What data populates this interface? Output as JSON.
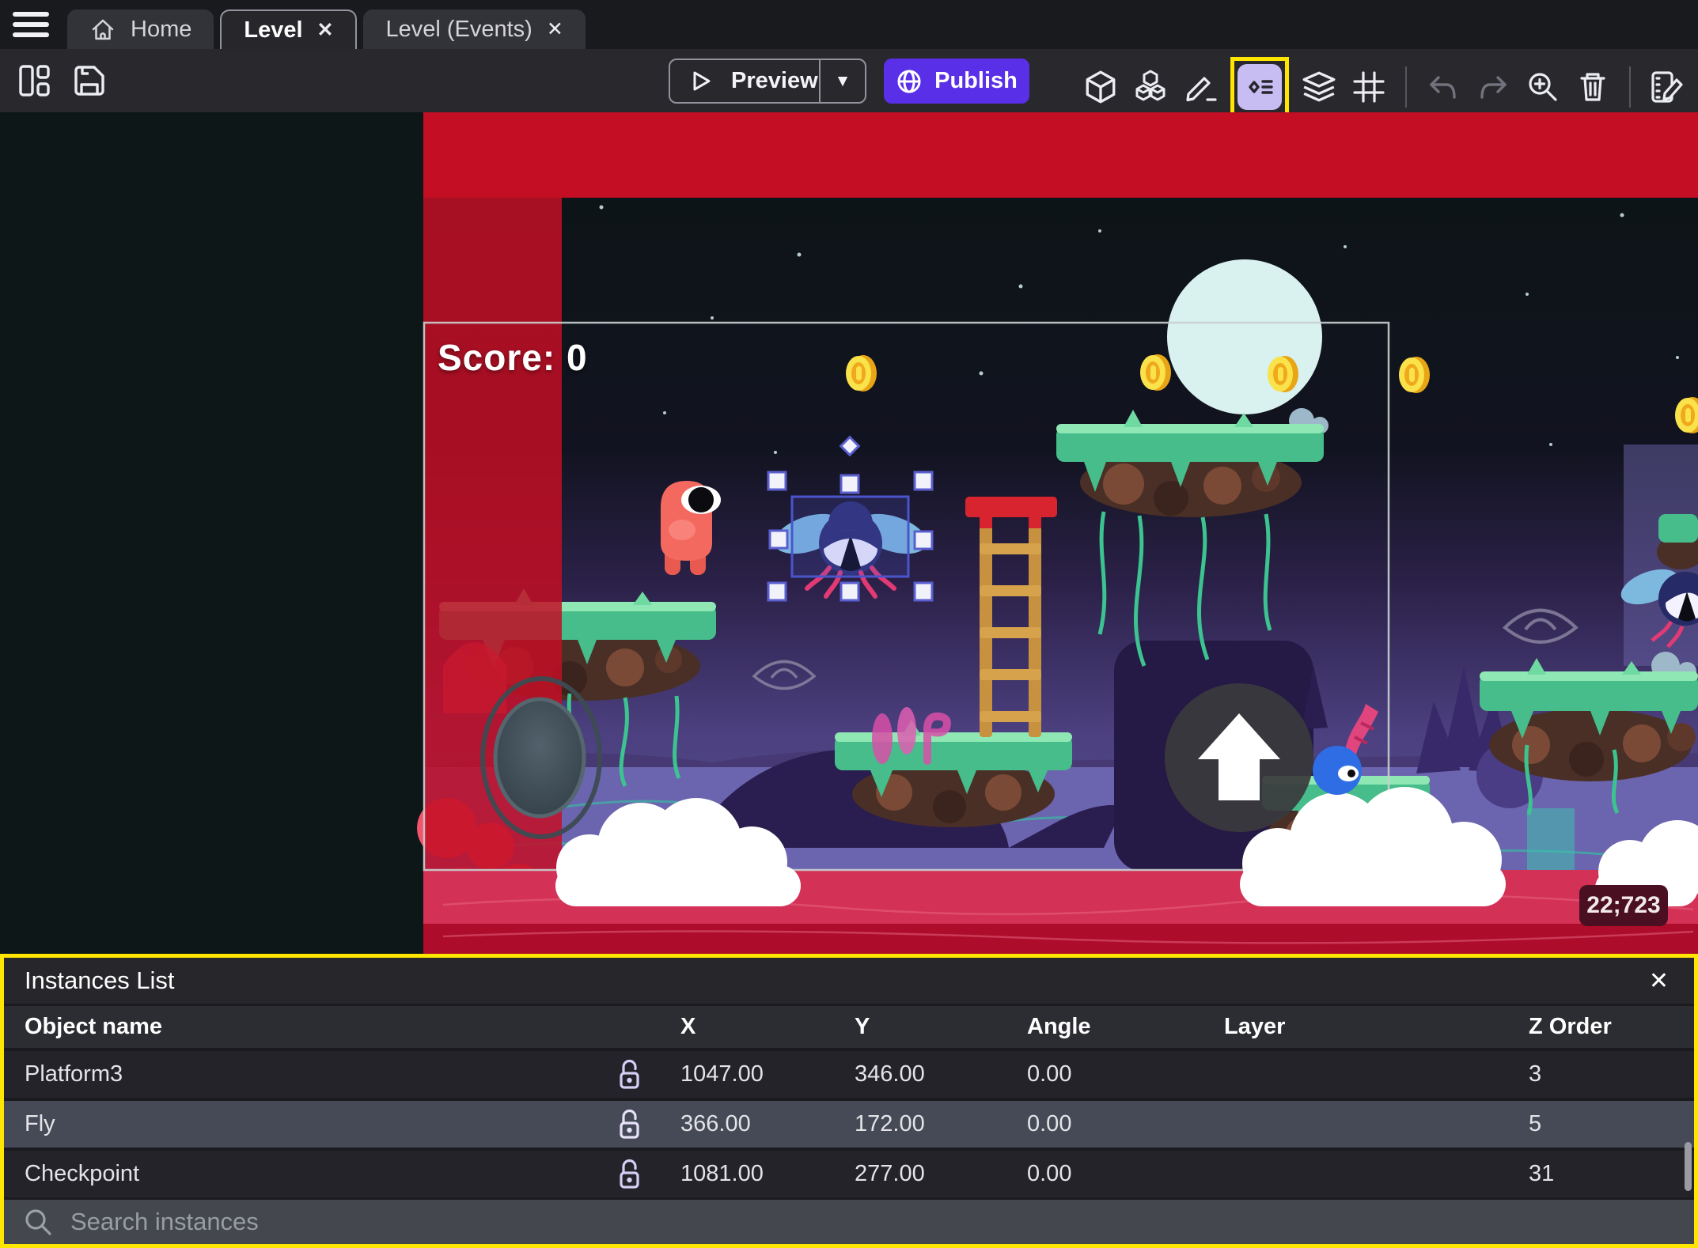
{
  "tabs": {
    "home": "Home",
    "level": "Level",
    "events": "Level (Events)"
  },
  "icons": {
    "close": "✕",
    "caret": "▼"
  },
  "toolbar": {
    "preview": "Preview",
    "publish": "Publish"
  },
  "canvas": {
    "score": "Score: 0",
    "coords": "22;723"
  },
  "panel": {
    "title": "Instances List",
    "columns": {
      "name": "Object name",
      "x": "X",
      "y": "Y",
      "angle": "Angle",
      "layer": "Layer",
      "z": "Z Order"
    },
    "rows": [
      {
        "name": "Platform3",
        "x": "1047.00",
        "y": "346.00",
        "angle": "0.00",
        "layer": "",
        "z": "3"
      },
      {
        "name": "Fly",
        "x": "366.00",
        "y": "172.00",
        "angle": "0.00",
        "layer": "",
        "z": "5"
      },
      {
        "name": "Checkpoint",
        "x": "1081.00",
        "y": "277.00",
        "angle": "0.00",
        "layer": "",
        "z": "31"
      }
    ],
    "search_placeholder": "Search instances"
  },
  "colors": {
    "highlight": "#FFE600",
    "publish": "#5A2FE8",
    "instances_chip": "#C8BDF2",
    "out_of_bounds_red": "#C30E24",
    "selection_blue": "#4A55CC"
  }
}
